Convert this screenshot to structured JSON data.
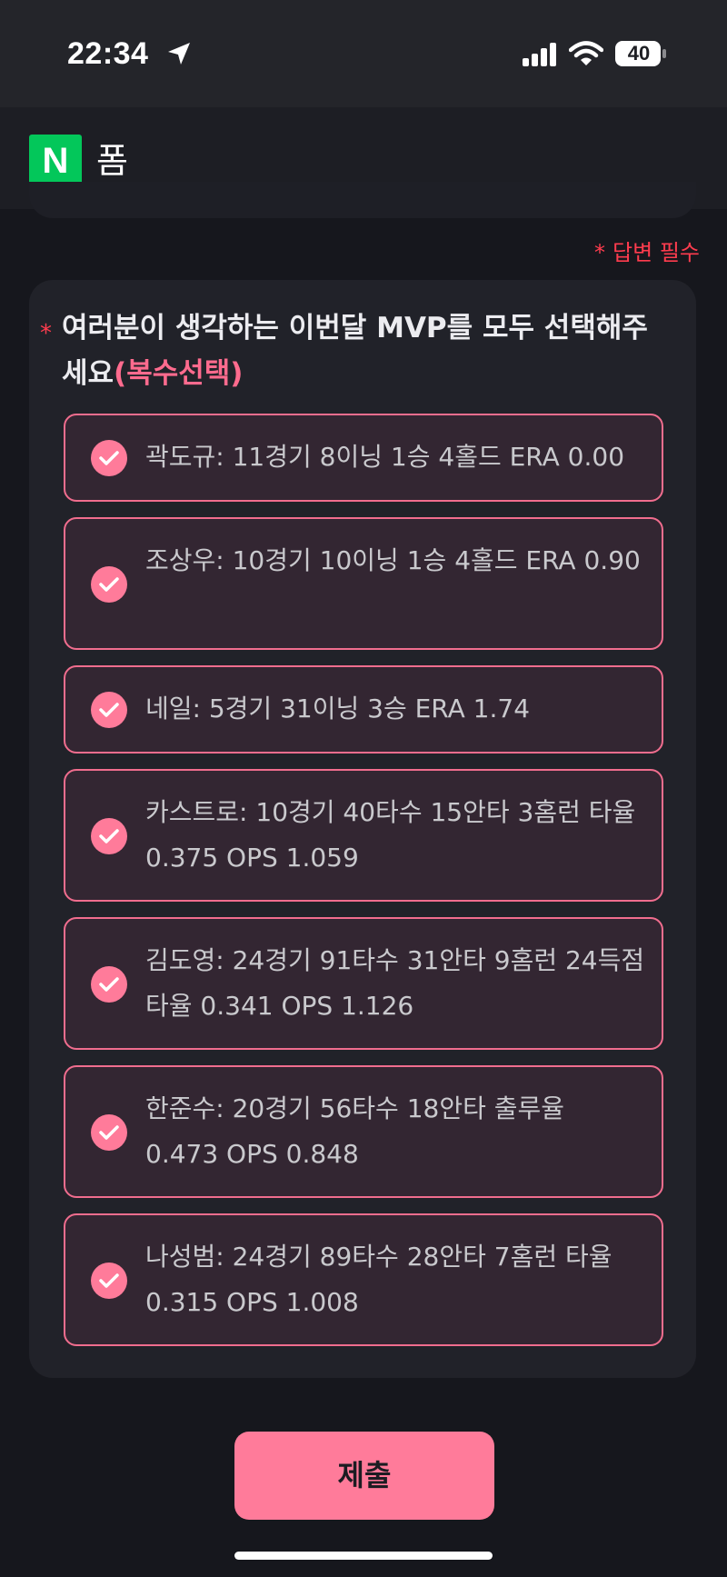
{
  "status_bar": {
    "time": "22:34",
    "battery": "40",
    "icons": [
      "location-arrow-icon",
      "cellular-signal-icon",
      "wifi-icon",
      "battery-icon"
    ]
  },
  "header": {
    "logo_letter": "N",
    "title": "폼",
    "logo_color": "#03c75a"
  },
  "required_note": {
    "star": "*",
    "text": "답변 필수"
  },
  "question": {
    "star": "*",
    "text": "여러분이 생각하는 이번달 MVP를 모두 선택해주세요",
    "multi_tag": "(복수선택)",
    "options": [
      {
        "label": "곽도규: 11경기 8이닝 1승 4홀드 ERA 0.00",
        "checked": true
      },
      {
        "label": "조상우: 10경기 10이닝 1승 4홀드 ERA 0.90",
        "checked": true
      },
      {
        "label": "네일: 5경기 31이닝 3승 ERA 1.74",
        "checked": true
      },
      {
        "label": "카스트로: 10경기 40타수 15안타 3홈런 타율 0.375 OPS 1.059",
        "checked": true
      },
      {
        "label": "김도영: 24경기 91타수 31안타 9홈런 24득점 타율 0.341 OPS 1.126",
        "checked": true
      },
      {
        "label": "한준수: 20경기 56타수 18안타 출루율 0.473 OPS 0.848",
        "checked": true
      },
      {
        "label": "나성범: 24경기 89타수 28안타 7홈런 타율 0.315 OPS 1.008",
        "checked": true
      }
    ]
  },
  "submit": {
    "label": "제출"
  },
  "colors": {
    "accent": "#ff7b9a",
    "required": "#ff3c4e",
    "background": "#16171d"
  }
}
